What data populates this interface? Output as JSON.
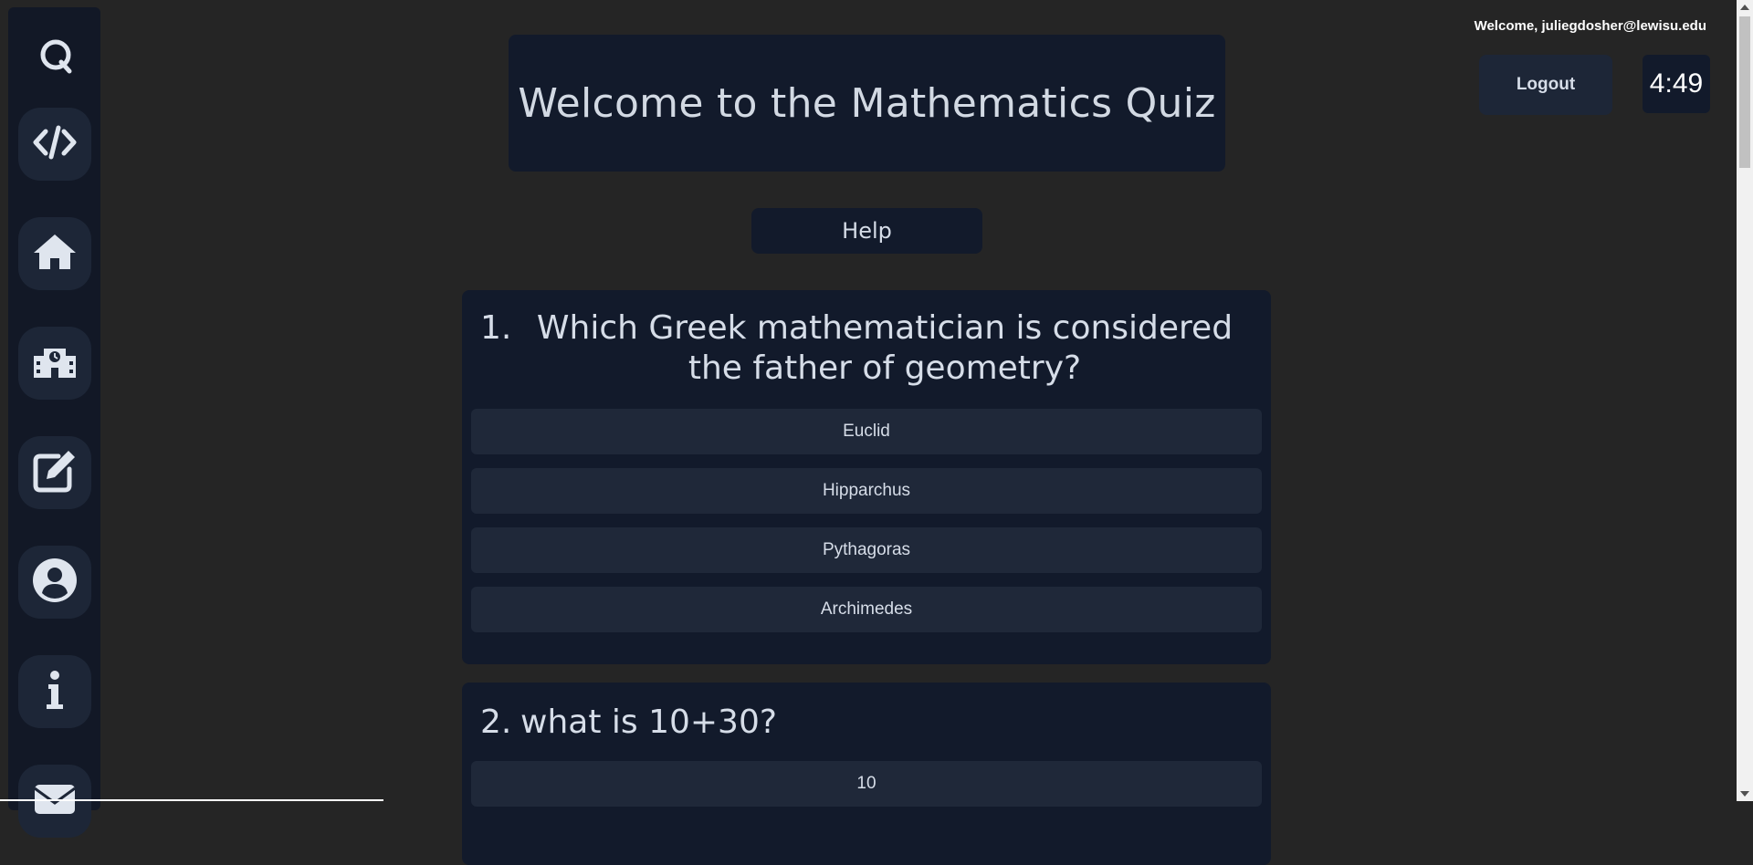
{
  "header": {
    "title": "Welcome to the Mathematics Quiz",
    "help_label": "Help"
  },
  "user": {
    "welcome_text": "Welcome, juliegdosher@lewisu.edu",
    "logout_label": "Logout",
    "timer": "4:49"
  },
  "sidebar": {
    "items": [
      {
        "icon": "code-icon"
      },
      {
        "icon": "home-icon"
      },
      {
        "icon": "school-icon"
      },
      {
        "icon": "edit-icon"
      },
      {
        "icon": "user-icon"
      },
      {
        "icon": "info-icon"
      },
      {
        "icon": "mail-icon"
      }
    ]
  },
  "questions": [
    {
      "number": "1.",
      "text": "Which Greek mathematician is considered the father of geometry?",
      "options": [
        "Euclid",
        "Hipparchus",
        "Pythagoras",
        "Archimedes"
      ]
    },
    {
      "number": "2.",
      "text": "what is 10+30?",
      "options": [
        "10"
      ]
    }
  ],
  "colors": {
    "page_bg": "#252525",
    "card_bg": "#121a2b",
    "option_bg": "#1f2839",
    "nav_btn_bg": "#1d2637"
  }
}
